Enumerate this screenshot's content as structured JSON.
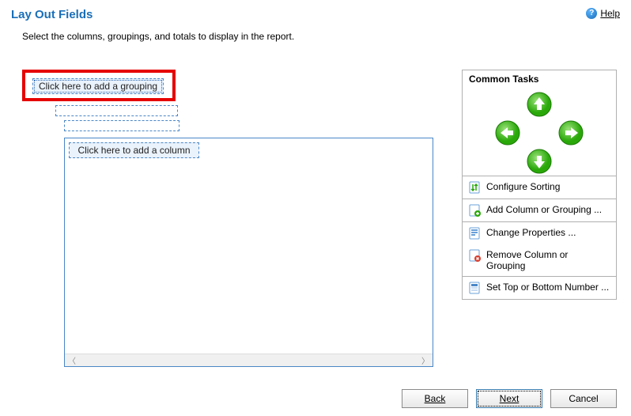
{
  "header": {
    "title": "Lay Out Fields",
    "help_label": "Help"
  },
  "instruction": "Select the columns, groupings, and totals to display in the report.",
  "placeholders": {
    "grouping": "Click here to add a grouping",
    "column": "Click here to add a column"
  },
  "tasks": {
    "title": "Common Tasks",
    "arrows": {
      "up": "move-up",
      "down": "move-down",
      "left": "move-left",
      "right": "move-right"
    },
    "groups": [
      [
        {
          "id": "configure-sorting",
          "label": "Configure Sorting",
          "icon": "sort"
        }
      ],
      [
        {
          "id": "add-column-grouping",
          "label": "Add Column or Grouping ...",
          "icon": "add"
        }
      ],
      [
        {
          "id": "change-properties",
          "label": "Change Properties ...",
          "icon": "props"
        },
        {
          "id": "remove-column-grouping",
          "label": "Remove Column or Grouping",
          "icon": "remove"
        }
      ],
      [
        {
          "id": "set-top-bottom",
          "label": "Set Top or Bottom Number ...",
          "icon": "topn"
        }
      ]
    ]
  },
  "buttons": {
    "back": "Back",
    "next": "Next",
    "cancel": "Cancel"
  }
}
